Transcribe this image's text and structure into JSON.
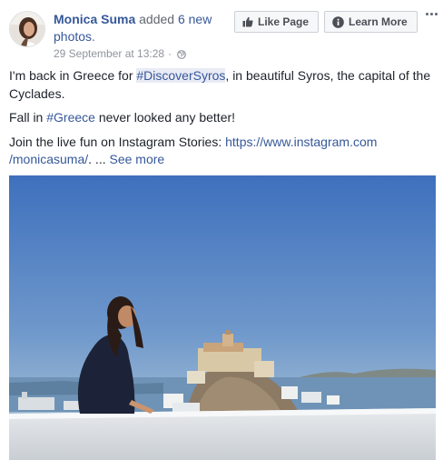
{
  "post": {
    "author": "Monica Suma",
    "action_prefix": " added ",
    "action_link": "6 new photos",
    "action_suffix": ".",
    "timestamp": "29 September at 13:28",
    "separator": "·",
    "privacy_icon": "globe-icon"
  },
  "buttons": {
    "like_page": "Like Page",
    "learn_more": "Learn More"
  },
  "text": {
    "p1_a": "I'm back in Greece for ",
    "p1_hashtag": "#DiscoverSyros",
    "p1_b": ", in beautiful Syros, the capital of the Cyclades.",
    "p2_a": "Fall in ",
    "p2_hashtag": "#Greece",
    "p2_b": " never looked any better!",
    "p3_a": "Join the live fun on Instagram Stories: ",
    "p3_url": "https://www.instagram.com /monicasuma/",
    "p3_b": ". ... ",
    "see_more": "See more"
  },
  "colors": {
    "link": "#365899",
    "text": "#1d2129",
    "muted": "#90949c",
    "sky_top": "#3e70bd",
    "sky_bottom": "#adc6d8"
  },
  "icons": {
    "like": "thumbs-up-icon",
    "info": "info-icon",
    "more": "more-options-icon"
  }
}
